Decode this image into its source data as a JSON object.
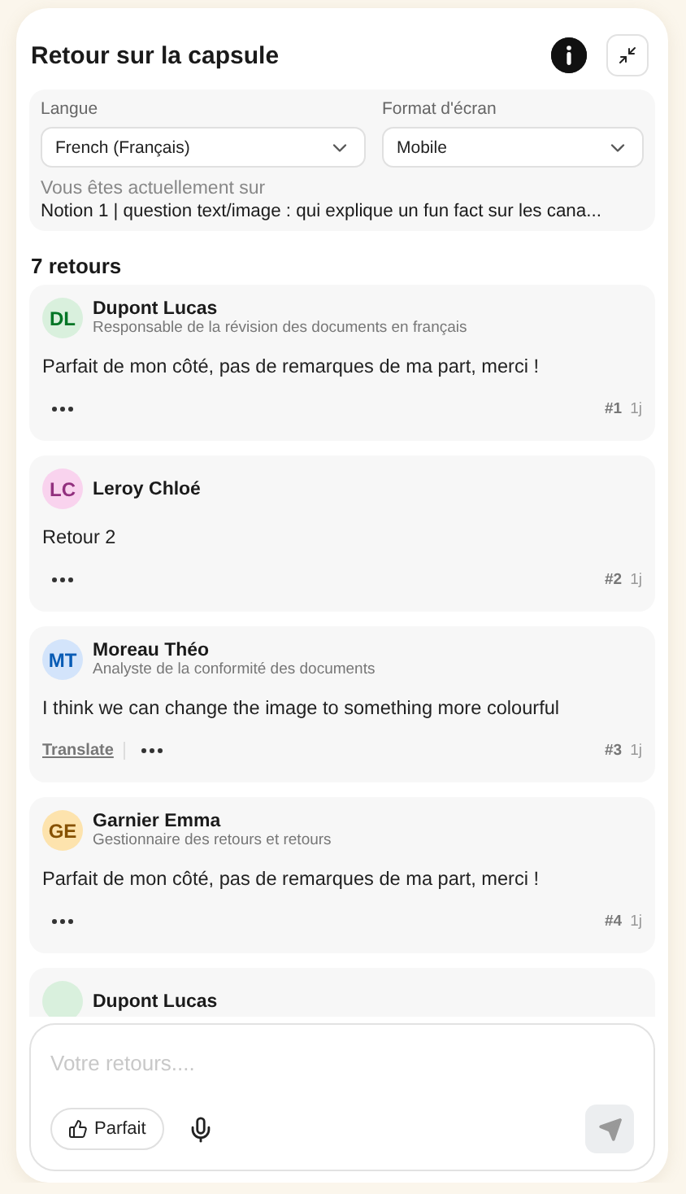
{
  "panel": {
    "title": "Retour sur la capsule"
  },
  "settings": {
    "language": {
      "label": "Langue",
      "value": "French (Français)"
    },
    "format": {
      "label": "Format d'écran",
      "value": "Mobile"
    },
    "location_label": "Vous êtes actuellement sur",
    "location": "Notion 1 | question text/image : qui explique un fun fact sur les cana..."
  },
  "count": "7 retours",
  "comments": [
    {
      "initials": "DL",
      "color": "#d9f0dd",
      "name": "Dupont Lucas",
      "role": "Responsable de la révision des documents en français",
      "text": "Parfait de mon côté, pas de remarques de ma part, merci !",
      "number": "#1",
      "age": "1j"
    },
    {
      "initials": "LC",
      "color": "#f9d3ee",
      "name": "Leroy Chloé",
      "text": "Retour 2",
      "number": "#2",
      "age": "1j"
    },
    {
      "initials": "MT",
      "color": "#d3e4fb",
      "name": "Moreau Théo",
      "role": "Analyste de la conformité des documents",
      "text": "I think we can change the image to something more colourful",
      "translate": "Translate",
      "number": "#3",
      "age": "1j"
    },
    {
      "initials": "GE",
      "color": "#fde3ad",
      "name": "Garnier Emma",
      "role": "Gestionnaire des retours et retours",
      "text": "Parfait de mon côté, pas de remarques de ma part, merci !",
      "number": "#4",
      "age": "1j"
    },
    {
      "color": "#d9f0dd",
      "name": "Dupont Lucas"
    }
  ],
  "composer": {
    "placeholder": "Votre retours....",
    "quick_reply": "Parfait"
  }
}
